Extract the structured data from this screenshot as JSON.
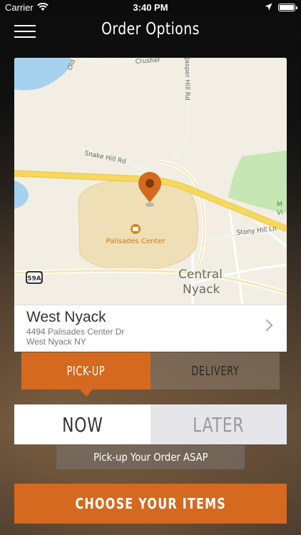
{
  "status_bar": {
    "carrier": "Carrier",
    "time": "3:40 PM"
  },
  "header": {
    "title": "Order Options",
    "menu_icon": "hamburger-menu-icon"
  },
  "map": {
    "labels": {
      "road_snake_hill": "Snake Hill Rd",
      "road_jasper_hill": "Jasper Hill Rd",
      "road_crusher": "Crusher",
      "road_old": "Old",
      "road_stony_hill": "Stony Hill Ln",
      "poi": "Palisades Center",
      "town_line1": "Central",
      "town_line2": "Nyack",
      "exit_shield": "59A",
      "park_partial1": "M",
      "park_partial2": "Vi"
    },
    "colors": {
      "land": "#f3eee3",
      "water": "#a7d2ef",
      "park": "#c6e6b4",
      "highway": "#f6d95a",
      "mall": "#efdfb6",
      "pin": "#d4691f"
    }
  },
  "location": {
    "name": "West Nyack",
    "address_line1": "4494 Palisades Center Dr",
    "address_line2": "West Nyack NY"
  },
  "order_type": {
    "pickup_label": "PICK-UP",
    "delivery_label": "DELIVERY",
    "selected": "PICK-UP"
  },
  "order_time": {
    "now_label": "NOW",
    "later_label": "LATER",
    "selected": "NOW"
  },
  "info": {
    "asap_text": "Pick-up Your Order ASAP"
  },
  "cta": {
    "label": "CHOOSE YOUR ITEMS"
  },
  "colors": {
    "accent": "#d4691f"
  }
}
